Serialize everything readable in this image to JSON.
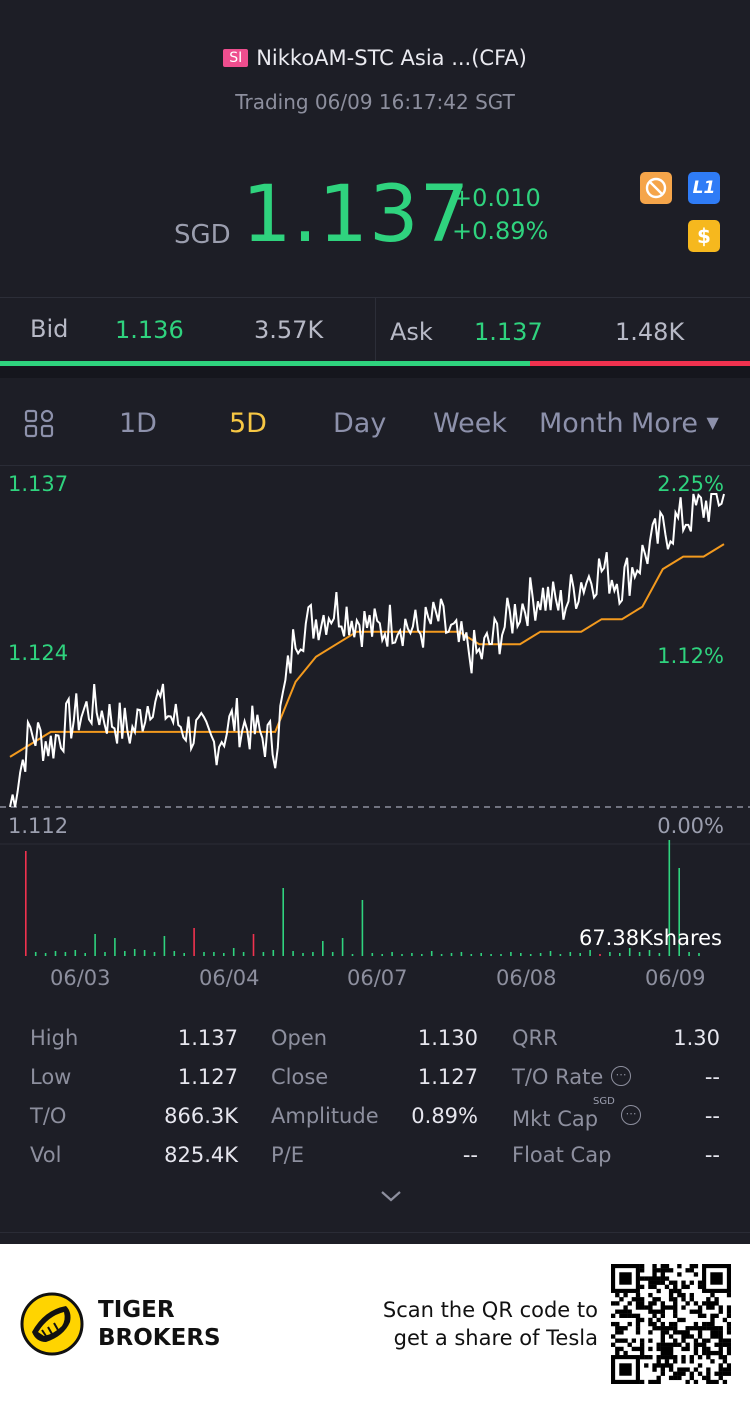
{
  "header": {
    "badge": "SI",
    "title": "NikkoAM-STC Asia ...(CFA)",
    "status": "Trading 06/09 16:17:42 SGT"
  },
  "quote": {
    "currency": "SGD",
    "price": "1.137",
    "change": "+0.010",
    "change_pct": "+0.89%",
    "icon_l1": "L1",
    "icon_dollar": "$"
  },
  "bidask": {
    "bid_label": "Bid",
    "bid_price": "1.136",
    "bid_size": "3.57K",
    "ask_label": "Ask",
    "ask_price": "1.137",
    "ask_size": "1.48K",
    "bid_share": 0.707
  },
  "tabs": {
    "items": [
      "1D",
      "5D",
      "Day",
      "Week",
      "Month",
      "More"
    ],
    "active": "5D"
  },
  "chart": {
    "y_top": "1.137",
    "y_mid": "1.124",
    "y_bottom": "1.112",
    "pct_top": "2.25%",
    "pct_mid": "1.12%",
    "pct_bottom": "0.00%",
    "volume_label": "67.38Kshares",
    "dates": [
      "06/03",
      "06/04",
      "06/07",
      "06/08",
      "06/09"
    ],
    "colors": {
      "price": "#ffffff",
      "avg": "#f39a1e",
      "up": "#2fd37e",
      "down": "#f0324f"
    }
  },
  "chart_data": {
    "type": "line",
    "ylim": [
      1.112,
      1.137
    ],
    "x_categories": [
      "06/03",
      "06/04",
      "06/07",
      "06/08",
      "06/09"
    ],
    "series": [
      {
        "values": [
          1.112,
          1.118,
          1.117,
          1.119,
          1.12,
          1.119,
          1.118,
          1.121,
          1.119,
          1.118,
          1.117,
          1.119,
          1.118,
          1.117,
          1.126,
          1.127,
          1.128,
          1.127,
          1.126,
          1.127,
          1.126,
          1.127,
          1.125,
          1.124,
          1.126,
          1.128,
          1.129,
          1.128,
          1.13,
          1.131,
          1.13,
          1.132,
          1.134,
          1.135,
          1.136,
          1.137
        ]
      },
      {
        "values": [
          1.116,
          1.117,
          1.118,
          1.118,
          1.118,
          1.118,
          1.118,
          1.118,
          1.118,
          1.118,
          1.118,
          1.118,
          1.118,
          1.118,
          1.122,
          1.124,
          1.125,
          1.126,
          1.126,
          1.126,
          1.126,
          1.126,
          1.126,
          1.125,
          1.125,
          1.125,
          1.126,
          1.126,
          1.126,
          1.127,
          1.127,
          1.128,
          1.131,
          1.132,
          1.132,
          1.133
        ]
      }
    ]
  },
  "stats": {
    "rows": [
      [
        {
          "label": "High",
          "value": "1.137"
        },
        {
          "label": "Open",
          "value": "1.130"
        },
        {
          "label": "QRR",
          "value": "1.30"
        }
      ],
      [
        {
          "label": "Low",
          "value": "1.127"
        },
        {
          "label": "Close",
          "value": "1.127"
        },
        {
          "label": "T/O Rate",
          "value": "--"
        }
      ],
      [
        {
          "label": "T/O",
          "value": "866.3K"
        },
        {
          "label": "Amplitude",
          "value": "0.89%"
        },
        {
          "label": "Mkt Cap",
          "value": "--"
        }
      ],
      [
        {
          "label": "Vol",
          "value": "825.4K"
        },
        {
          "label": "P/E",
          "value": "--"
        },
        {
          "label": "Float Cap",
          "value": "--"
        }
      ]
    ],
    "mkt_cap_unit": "SGD"
  },
  "footer": {
    "brand_line1": "TIGER",
    "brand_line2": "BROKERS",
    "qr_line1": "Scan the QR code to",
    "qr_line2": "get a share of Tesla"
  }
}
